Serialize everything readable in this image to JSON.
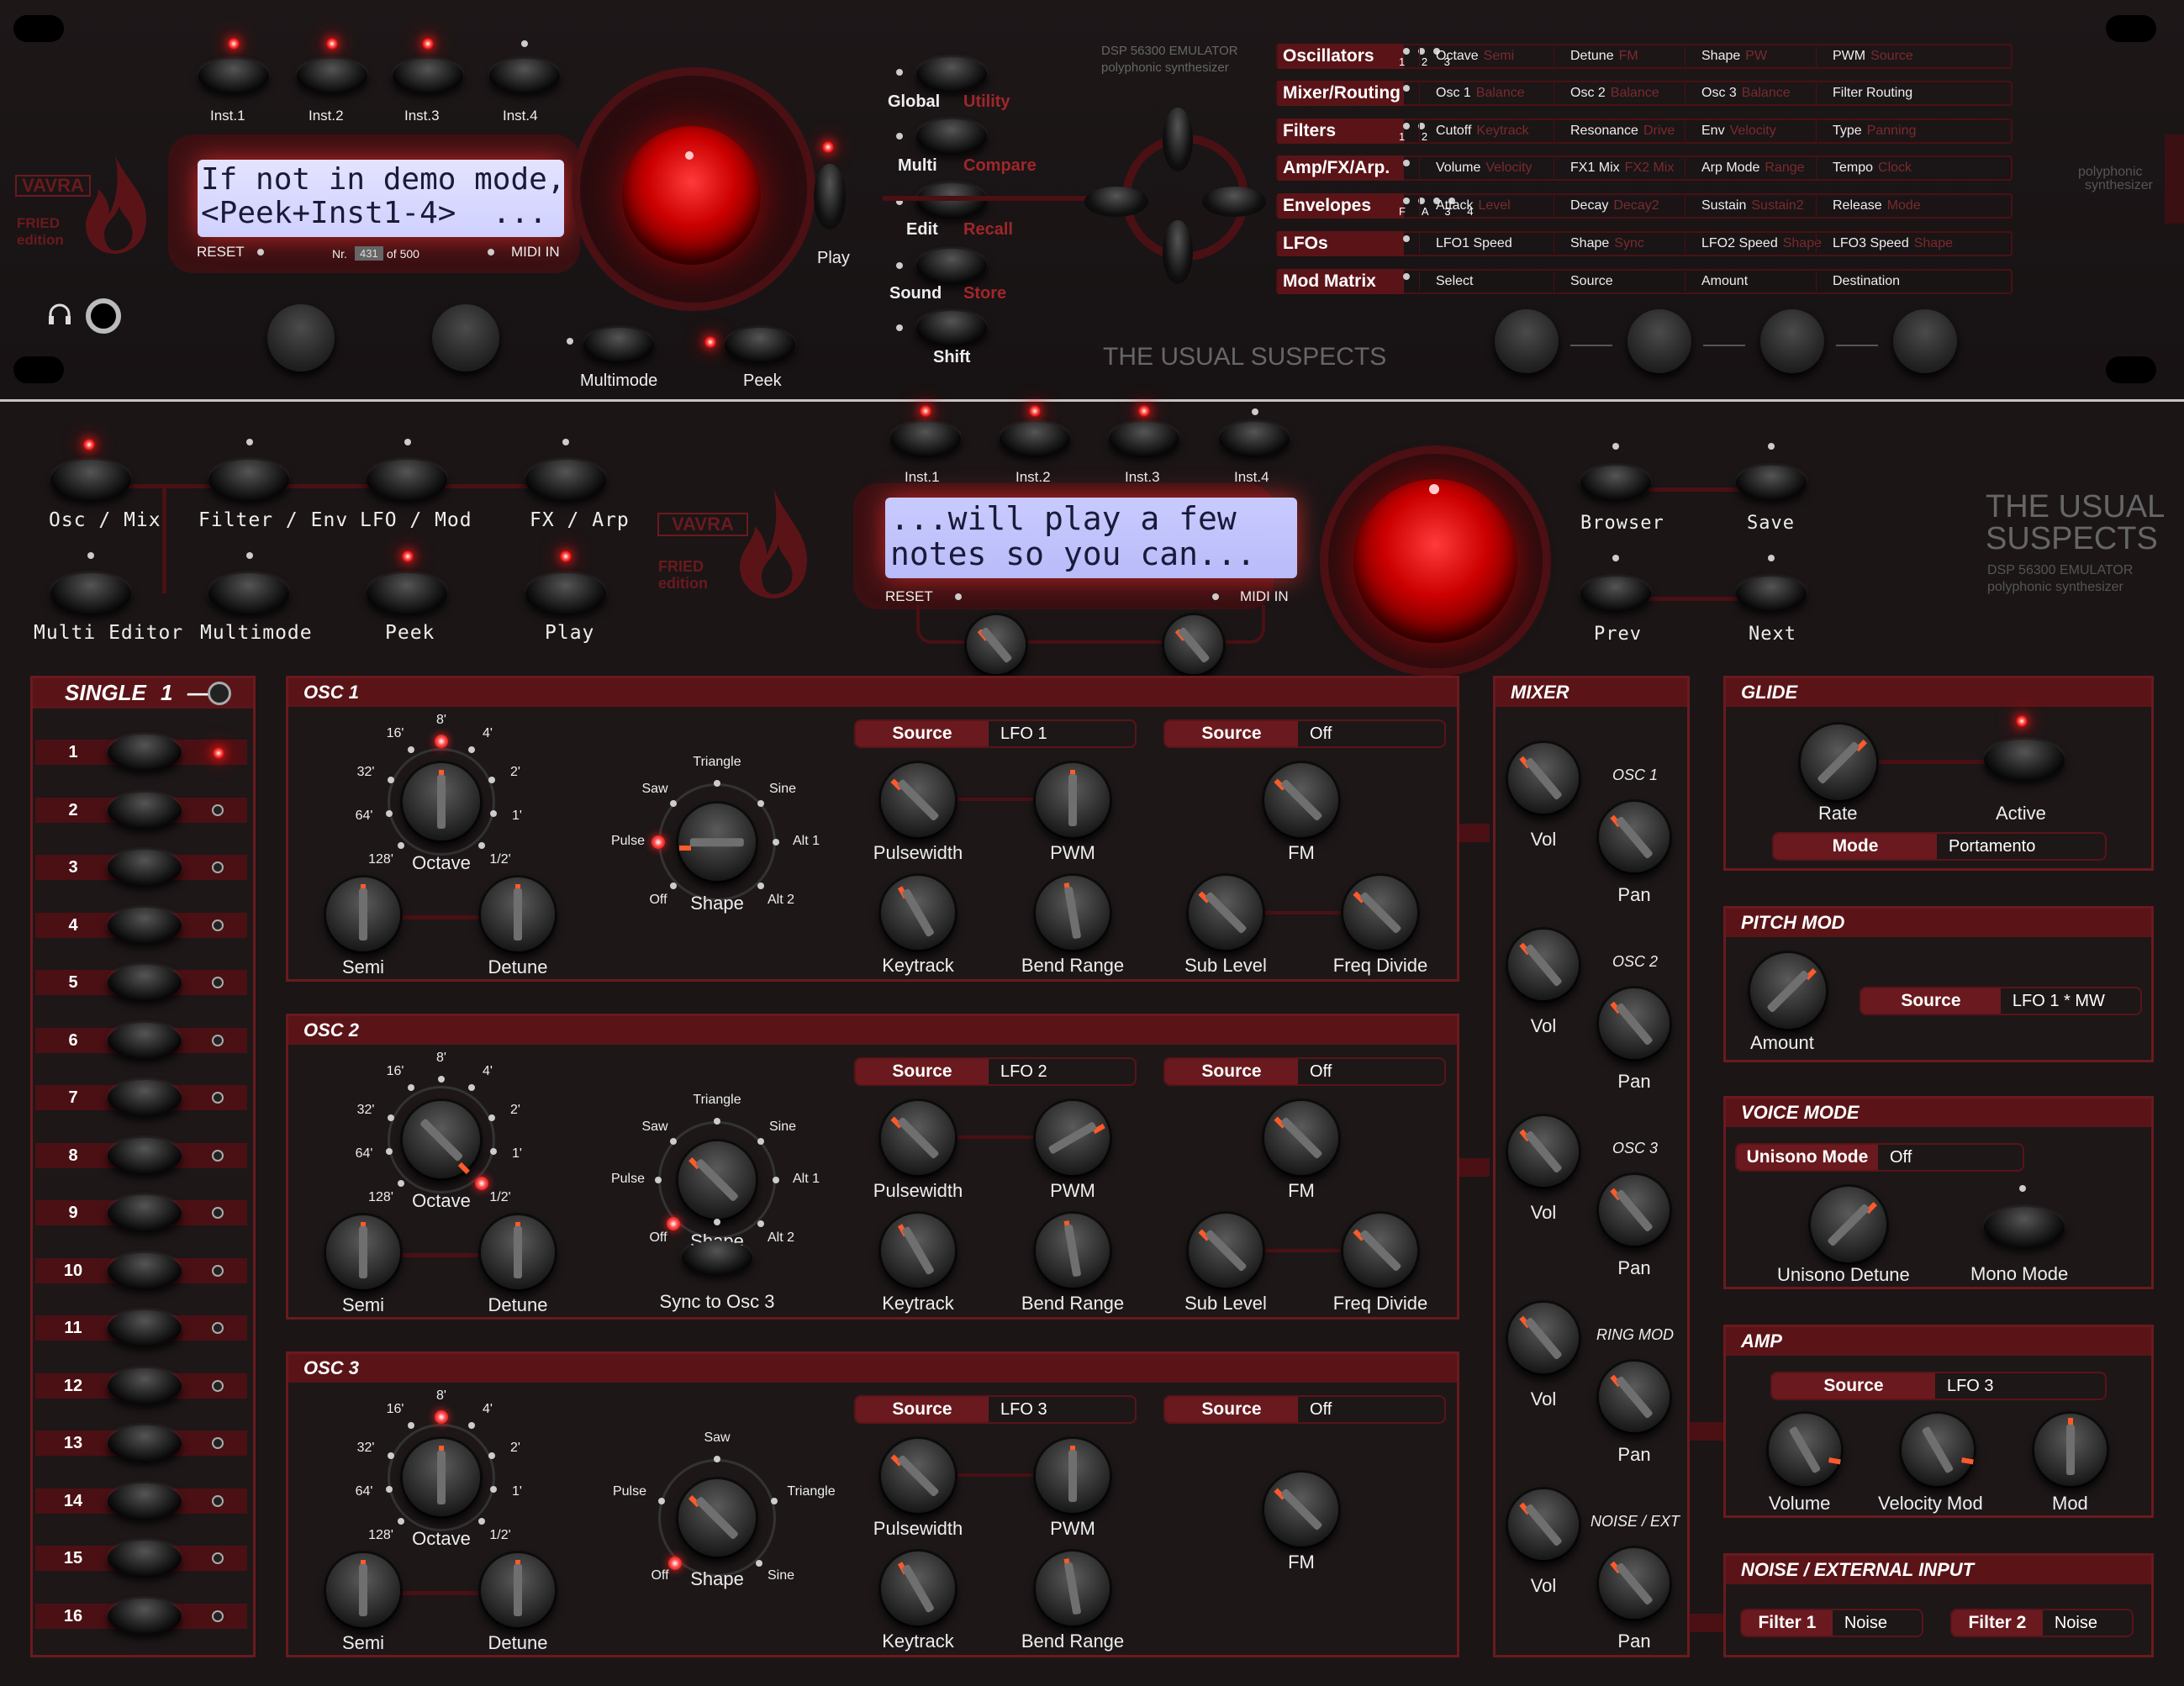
{
  "top": {
    "inst_buttons": [
      "Inst.1",
      "Inst.2",
      "Inst.3",
      "Inst.4"
    ],
    "lcd_line1": "If not in demo mode,",
    "lcd_line2": "<Peek+Inst1-4>  ...",
    "reset": "RESET",
    "nr": "Nr.",
    "nr_value": "431",
    "of": "of 500",
    "midi_in": "MIDI IN",
    "brand": "VAVRA",
    "brand_sub1": "FRIED",
    "brand_sub2": "edition",
    "play": "Play",
    "multimode": "Multimode",
    "peek": "Peek",
    "nav": [
      {
        "label": "Global",
        "alt": "Utility"
      },
      {
        "label": "Multi",
        "alt": "Compare"
      },
      {
        "label": "Edit",
        "alt": "Recall"
      },
      {
        "label": "Sound",
        "alt": "Store"
      }
    ],
    "shift": "Shift",
    "dsp_line1": "DSP 56300  EMULATOR",
    "dsp_line2": "polyphonic synthesizer",
    "usual": "THE USUAL SUSPECTS",
    "side_small1": "polyphonic",
    "side_small2": "synthesizer",
    "menu": [
      {
        "title": "Oscillators",
        "nums": "1 2 3",
        "items": [
          [
            "Octave",
            "Semi"
          ],
          [
            "Detune",
            "FM"
          ],
          [
            "Shape",
            "PW"
          ],
          [
            "PWM",
            "Source"
          ]
        ]
      },
      {
        "title": "Mixer/Routing",
        "nums": "",
        "items": [
          [
            "Osc 1",
            "Balance"
          ],
          [
            "Osc 2",
            "Balance"
          ],
          [
            "Osc 3",
            "Balance"
          ],
          [
            "Filter Routing",
            ""
          ]
        ]
      },
      {
        "title": "Filters",
        "nums": "1 2",
        "items": [
          [
            "Cutoff",
            "Keytrack"
          ],
          [
            "Resonance",
            "Drive"
          ],
          [
            "Env",
            "Velocity"
          ],
          [
            "Type",
            "Panning"
          ]
        ]
      },
      {
        "title": "Amp/FX/Arp.",
        "nums": "",
        "items": [
          [
            "Volume",
            "Velocity"
          ],
          [
            "FX1 Mix",
            "FX2 Mix"
          ],
          [
            "Arp Mode",
            "Range"
          ],
          [
            "Tempo",
            "Clock"
          ]
        ]
      },
      {
        "title": "Envelopes",
        "nums": "F A 3 4",
        "items": [
          [
            "Attack",
            "Level"
          ],
          [
            "Decay",
            "Decay2"
          ],
          [
            "Sustain",
            "Sustain2"
          ],
          [
            "Release",
            "Mode"
          ]
        ]
      },
      {
        "title": "LFOs",
        "nums": "",
        "items": [
          [
            "LFO1 Speed",
            ""
          ],
          [
            "Shape",
            "Sync"
          ],
          [
            "LFO2 Speed",
            "Shape"
          ],
          [
            "LFO3 Speed",
            "Shape"
          ]
        ]
      },
      {
        "title": "Mod Matrix",
        "nums": "",
        "items": [
          [
            "Select",
            ""
          ],
          [
            "Source",
            ""
          ],
          [
            "Amount",
            ""
          ],
          [
            "Destination",
            ""
          ]
        ]
      }
    ]
  },
  "nav2": {
    "buttons": [
      "Osc / Mix",
      "Filter / Env",
      "LFO / Mod",
      "FX / Arp",
      "Multi Editor",
      "Multimode",
      "Peek",
      "Play"
    ],
    "inst": [
      "Inst.1",
      "Inst.2",
      "Inst.3",
      "Inst.4"
    ],
    "lcd_line1": "...will play a few",
    "lcd_line2": "notes so you can...",
    "reset": "RESET",
    "midi_in": "MIDI IN",
    "brand": "VAVRA",
    "brand_sub1": "FRIED",
    "brand_sub2": "edition",
    "browser": "Browser",
    "save": "Save",
    "prev": "Prev",
    "next": "Next",
    "usual1": "THE USUAL",
    "usual2": "SUSPECTS",
    "dsp1": "DSP 56300  EMULATOR",
    "dsp2": "polyphonic synthesizer"
  },
  "single": {
    "title": "SINGLE",
    "num": "1",
    "dash": "—",
    "slots": [
      "1",
      "2",
      "3",
      "4",
      "5",
      "6",
      "7",
      "8",
      "9",
      "10",
      "11",
      "12",
      "13",
      "14",
      "15",
      "16"
    ]
  },
  "osc1": {
    "title": "OSC 1",
    "oct": [
      "16'",
      "8'",
      "4'",
      "2'",
      "1'",
      "1/2'",
      "128'",
      "64'",
      "32'"
    ],
    "octave": "Octave",
    "shapes": [
      "Triangle",
      "Saw",
      "Sine",
      "Pulse",
      "Alt 1",
      "Off",
      "Alt 2"
    ],
    "shape": "Shape",
    "src_k": "Source",
    "src_v": "LFO 1",
    "src2_k": "Source",
    "src2_v": "Off",
    "pw": "Pulsewidth",
    "pwm": "PWM",
    "fm": "FM",
    "keytrack": "Keytrack",
    "bend": "Bend Range",
    "sub": "Sub Level",
    "freq": "Freq Divide",
    "semi": "Semi",
    "detune": "Detune"
  },
  "osc2": {
    "title": "OSC 2",
    "oct": [
      "16'",
      "8'",
      "4'",
      "2'",
      "1'",
      "1/2'",
      "128'",
      "64'",
      "32'"
    ],
    "octave": "Octave",
    "shapes": [
      "Triangle",
      "Saw",
      "Sine",
      "Pulse",
      "Alt 1",
      "Off",
      "Alt 2"
    ],
    "shape": "Shape",
    "sync": "Sync to Osc 3",
    "src_k": "Source",
    "src_v": "LFO 2",
    "src2_k": "Source",
    "src2_v": "Off",
    "pw": "Pulsewidth",
    "pwm": "PWM",
    "fm": "FM",
    "keytrack": "Keytrack",
    "bend": "Bend Range",
    "sub": "Sub Level",
    "freq": "Freq Divide",
    "semi": "Semi",
    "detune": "Detune"
  },
  "osc3": {
    "title": "OSC 3",
    "oct": [
      "16'",
      "8'",
      "4'",
      "2'",
      "1'",
      "1/2'",
      "128'",
      "64'",
      "32'"
    ],
    "octave": "Octave",
    "shapes": [
      "Saw",
      "Pulse",
      "Triangle",
      "Off",
      "Sine"
    ],
    "shape": "Shape",
    "src_k": "Source",
    "src_v": "LFO 3",
    "src2_k": "Source",
    "src2_v": "Off",
    "pw": "Pulsewidth",
    "pwm": "PWM",
    "fm": "FM",
    "keytrack": "Keytrack",
    "bend": "Bend Range",
    "semi": "Semi",
    "detune": "Detune"
  },
  "mixer": {
    "title": "MIXER",
    "vol": "Vol",
    "pan": "Pan",
    "ch": [
      "OSC 1",
      "OSC 2",
      "OSC 3",
      "RING MOD",
      "NOISE / EXT"
    ]
  },
  "glide": {
    "title": "GLIDE",
    "rate": "Rate",
    "active": "Active",
    "mode_k": "Mode",
    "mode_v": "Portamento"
  },
  "pitchmod": {
    "title": "PITCH MOD",
    "amount": "Amount",
    "src_k": "Source",
    "src_v": "LFO 1 * MW"
  },
  "voicemode": {
    "title": "VOICE MODE",
    "uni_k": "Unisono Mode",
    "uni_v": "Off",
    "detune": "Unisono Detune",
    "mono": "Mono Mode"
  },
  "amp": {
    "title": "AMP",
    "src_k": "Source",
    "src_v": "LFO 3",
    "volume": "Volume",
    "velmod": "Velocity Mod",
    "mod": "Mod"
  },
  "noise": {
    "title": "NOISE / EXTERNAL INPUT",
    "f1_k": "Filter 1",
    "f1_v": "Noise",
    "f2_k": "Filter 2",
    "f2_v": "Noise"
  }
}
